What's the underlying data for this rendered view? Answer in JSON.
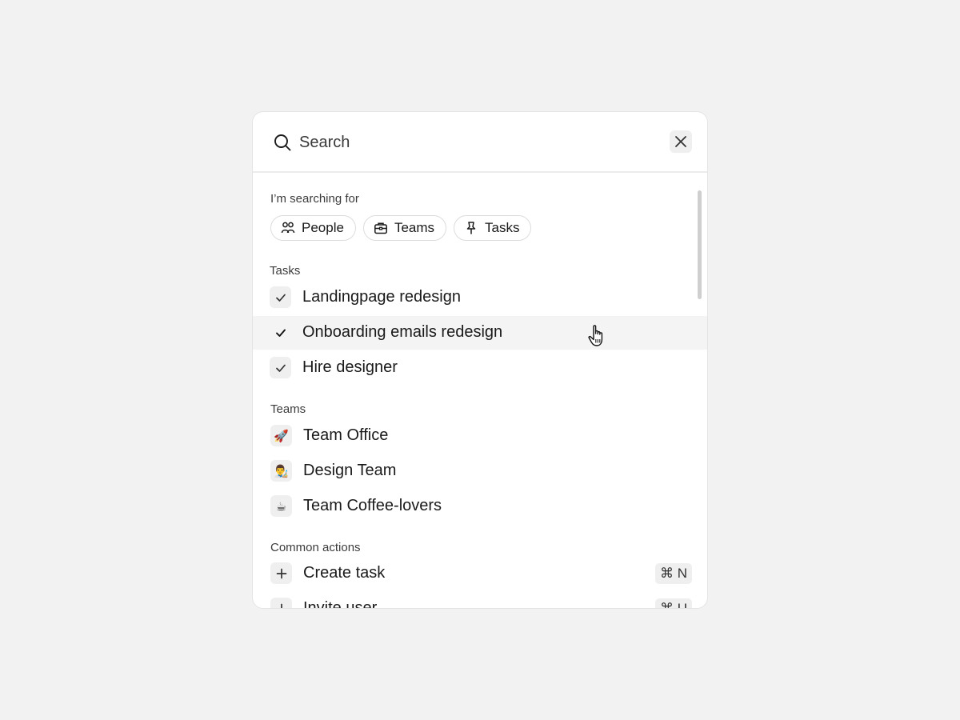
{
  "search": {
    "placeholder": "Search",
    "value": ""
  },
  "filters": {
    "label": "I’m searching for",
    "chips": [
      {
        "label": "People",
        "icon": "people-icon"
      },
      {
        "label": "Teams",
        "icon": "briefcase-icon"
      },
      {
        "label": "Tasks",
        "icon": "pin-icon"
      }
    ]
  },
  "tasks": {
    "label": "Tasks",
    "items": [
      {
        "label": "Landingpage redesign",
        "icon": "check-icon"
      },
      {
        "label": "Onboarding emails redesign",
        "icon": "check-icon",
        "highlighted": true
      },
      {
        "label": "Hire designer",
        "icon": "check-icon"
      }
    ]
  },
  "teams": {
    "label": "Teams",
    "items": [
      {
        "label": "Team Office",
        "emoji": "🚀"
      },
      {
        "label": "Design Team",
        "emoji": "👨‍🎨"
      },
      {
        "label": "Team Coffee-lovers",
        "emoji": "☕"
      }
    ]
  },
  "actions": {
    "label": "Common actions",
    "items": [
      {
        "label": "Create task",
        "icon": "plus-icon",
        "shortcut": "⌘ N"
      },
      {
        "label": "Invite user",
        "icon": "plus-icon",
        "shortcut": "⌘ U"
      }
    ]
  },
  "colors": {
    "background": "#f2f2f2",
    "panel": "#ffffff",
    "highlight": "#f4f4f4",
    "icon_bg": "#efefef"
  }
}
